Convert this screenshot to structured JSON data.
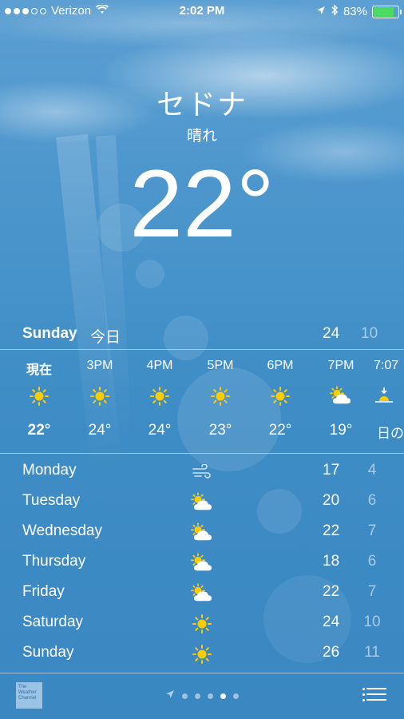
{
  "status_bar": {
    "signal_strength": "3 of 5",
    "carrier": "Verizon",
    "time": "2:02 PM",
    "battery_percent": "83%",
    "battery_level": 0.83,
    "icons": [
      "wifi-icon",
      "location-arrow-icon",
      "bluetooth-icon"
    ]
  },
  "location": {
    "city": "セドナ",
    "condition": "晴れ",
    "temperature": "22°"
  },
  "today": {
    "day": "Sunday",
    "label": "今日",
    "high": "24",
    "low": "10"
  },
  "hourly": [
    {
      "time": "現在",
      "icon": "sun-icon",
      "temp": "22°"
    },
    {
      "time": "3PM",
      "icon": "sun-icon",
      "temp": "24°"
    },
    {
      "time": "4PM",
      "icon": "sun-icon",
      "temp": "24°"
    },
    {
      "time": "5PM",
      "icon": "sun-icon",
      "temp": "23°"
    },
    {
      "time": "6PM",
      "icon": "sun-icon",
      "temp": "22°"
    },
    {
      "time": "7PM",
      "icon": "partly-cloudy-icon",
      "temp": "19°"
    },
    {
      "time": "7:07",
      "icon": "sunset-icon",
      "temp": "日の"
    }
  ],
  "daily": [
    {
      "day": "Monday",
      "icon": "wind-icon",
      "high": "17",
      "low": "4"
    },
    {
      "day": "Tuesday",
      "icon": "partly-cloudy-icon",
      "high": "20",
      "low": "6"
    },
    {
      "day": "Wednesday",
      "icon": "partly-cloudy-icon",
      "high": "22",
      "low": "7"
    },
    {
      "day": "Thursday",
      "icon": "partly-cloudy-icon",
      "high": "18",
      "low": "6"
    },
    {
      "day": "Friday",
      "icon": "partly-cloudy-icon",
      "high": "22",
      "low": "7"
    },
    {
      "day": "Saturday",
      "icon": "sun-icon",
      "high": "24",
      "low": "10"
    },
    {
      "day": "Sunday",
      "icon": "sun-icon",
      "high": "26",
      "low": "11"
    }
  ],
  "footer": {
    "provider": "The Weather Channel",
    "page_count": 6,
    "current_page": 4
  },
  "colors": {
    "sun": "#ffcc00",
    "battery": "#4cd964",
    "sky": "#4a95cc"
  }
}
